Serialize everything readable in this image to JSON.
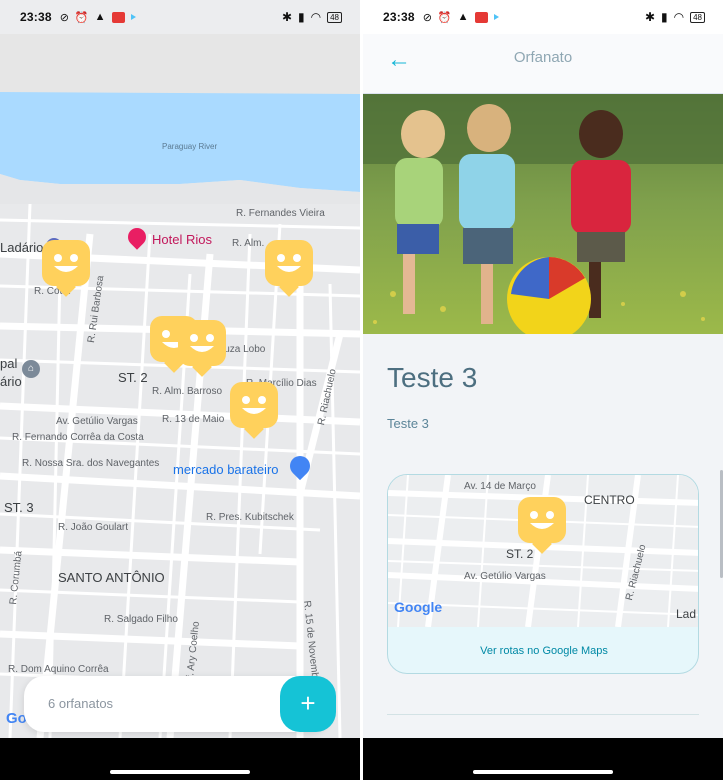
{
  "status": {
    "time": "23:38",
    "battery": "48"
  },
  "map_screen": {
    "labels": {
      "river": "Paraguay River",
      "fernandes": "R. Fernandes Vieira",
      "almp": "R. Alm.",
      "ladario": "Ladário",
      "cotia": "R. Cotia",
      "ruibarbosa": "R. Rui Barbosa",
      "luzalobo": "luza Lobo",
      "st2": "ST. 2",
      "almbarroso": "R. Alm. Barroso",
      "marcilio": "R. Marcílio Dias",
      "riachuelo": "R. Riachuelo",
      "treze": "R. 13 de Maio",
      "getulio": "Av. Getúlio Vargas",
      "fernando": "R. Fernando Corrêa da Costa",
      "nossa": "R. Nossa Sra. dos Navegantes",
      "st3": "ST. 3",
      "joao": "R. João Goulart",
      "kubitschek": "R. Pres. Kubitschek",
      "santo": "SANTO ANTÔNIO",
      "salgado": "R. Salgado Filho",
      "corumba": "R. Corumbá",
      "ary": "R. Prof. Ary Coelho",
      "quinze": "R. 15 de Novembro",
      "domaquino": "R. Dom Aquino Corrêa",
      "pal": "pal",
      "ario": "ário",
      "hotel": "Hotel Rios",
      "mercado": "mercado barateiro"
    },
    "bottom_bar": {
      "count_text": "6 orfanatos",
      "add_label": "+"
    },
    "google_partial": "Go"
  },
  "detail_screen": {
    "header": {
      "back_icon": "←",
      "title": "Orfanato"
    },
    "title": "Teste 3",
    "description": "Teste 3",
    "minimap": {
      "labels": {
        "av14": "Av. 14 de Março",
        "centro": "CENTRO",
        "st2": "ST. 2",
        "riachuelo": "R. Riachuelo",
        "getulio": "Av. Getúlio Vargas",
        "lad": "Lad"
      },
      "google": "Google"
    },
    "routes_link": "Ver rotas no Google Maps"
  },
  "colors": {
    "accent": "#15c3d6",
    "marker": "#ffd15c",
    "water": "#aadaff"
  }
}
